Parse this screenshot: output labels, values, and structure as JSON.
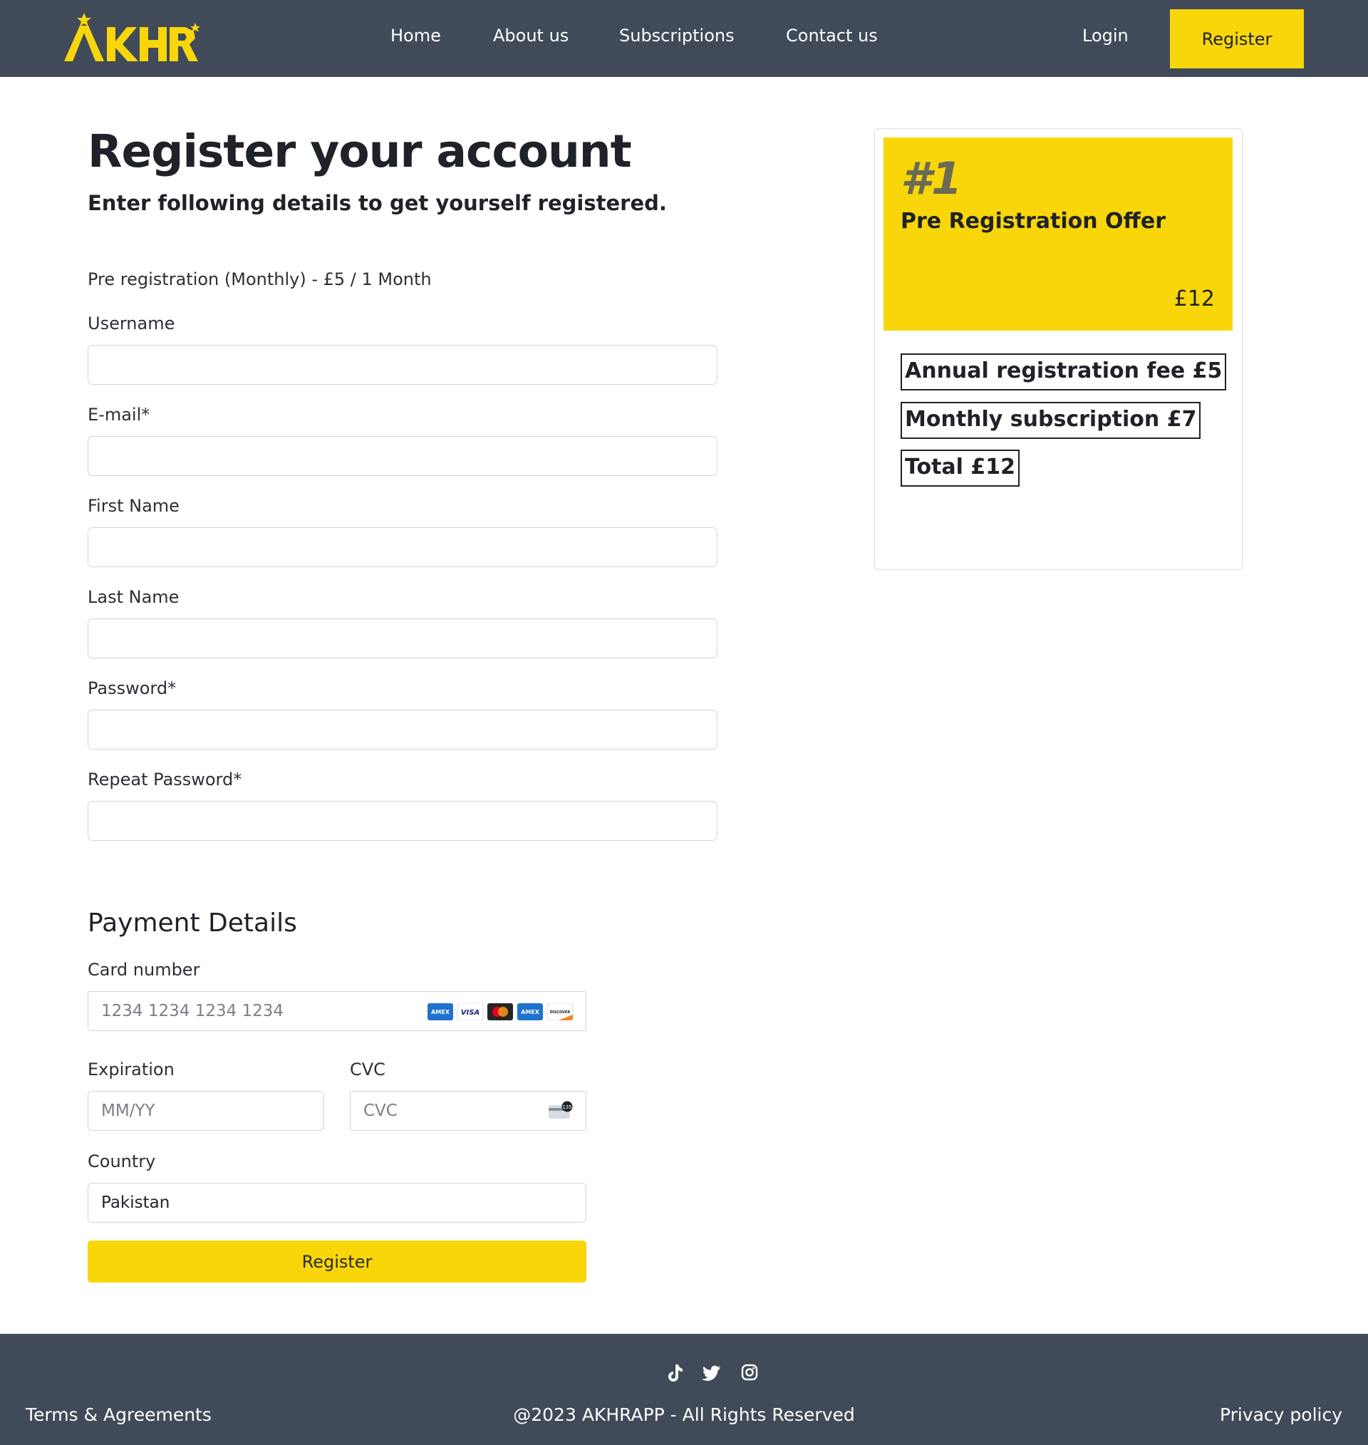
{
  "brand": {
    "logo_text": "AKHR",
    "accent_color": "#f8d60a",
    "header_color": "#404a59"
  },
  "nav": {
    "items": [
      {
        "label": "Home"
      },
      {
        "label": "About us"
      },
      {
        "label": "Subscriptions"
      },
      {
        "label": "Contact us"
      }
    ],
    "login_label": "Login",
    "register_label": "Register"
  },
  "form": {
    "title": "Register your account",
    "subtitle": "Enter following details to get yourself registered.",
    "plan_text": "Pre registration (Monthly) - £5 / 1 Month",
    "fields": {
      "username": {
        "label": "Username",
        "value": ""
      },
      "email": {
        "label": "E-mail*",
        "value": ""
      },
      "first_name": {
        "label": "First Name",
        "value": ""
      },
      "last_name": {
        "label": "Last Name",
        "value": ""
      },
      "password": {
        "label": "Password*",
        "value": ""
      },
      "repeat_password": {
        "label": "Repeat Password*",
        "value": ""
      }
    }
  },
  "payment": {
    "title": "Payment Details",
    "card_number": {
      "label": "Card number",
      "placeholder": "1234 1234 1234 1234"
    },
    "card_brands": [
      "amex-icon",
      "visa-icon",
      "mastercard-icon",
      "amex-icon",
      "discover-icon"
    ],
    "expiration": {
      "label": "Expiration",
      "placeholder": "MM/YY"
    },
    "cvc": {
      "label": "CVC",
      "placeholder": "CVC"
    },
    "country": {
      "label": "Country",
      "value": "Pakistan"
    },
    "submit_label": "Register"
  },
  "offer": {
    "rank": "#1",
    "title": "Pre Registration Offer",
    "price": "£12",
    "lines": [
      "Annual registration fee £5",
      "Monthly subscription £7",
      "Total £12"
    ]
  },
  "footer": {
    "social_icons": [
      "tiktok-icon",
      "twitter-icon",
      "instagram-icon"
    ],
    "terms_label": "Terms & Agreements",
    "copyright": "@2023 AKHRAPP - All Rights Reserved",
    "privacy_label": "Privacy policy"
  }
}
